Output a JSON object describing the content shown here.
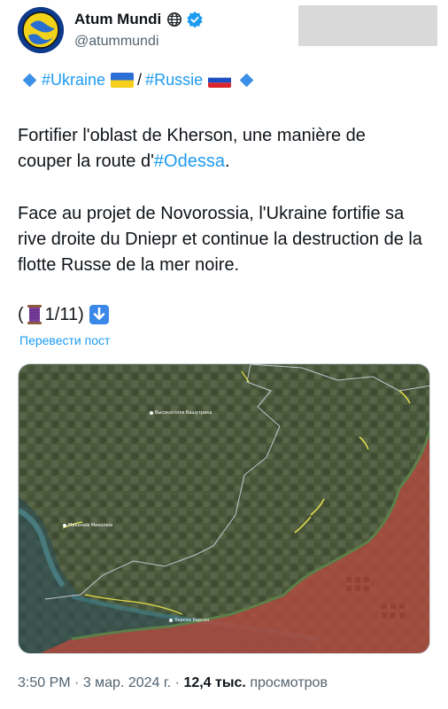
{
  "author": {
    "name": "Atum Mundi",
    "handle": "@atummundi"
  },
  "tags": {
    "ukraine": "#Ukraine",
    "separator": "/",
    "russie": "#Russie"
  },
  "post": {
    "line1_prefix": "Fortifier l'oblast de Kherson, une manière de",
    "line2_prefix": "couper la route d'",
    "line2_tag": "#Odessa",
    "line2_suffix": ".",
    "paragraph2": "Face au projet de Novorossia, l'Ukraine fortifie sa rive droite du Dniepr et continue la destruction de la flotte Russe de la mer noire.",
    "thread_open": "(",
    "thread_count": "1/11)",
    "translate": "Перевести пост"
  },
  "map": {
    "labels": {
      "vysokopillia": "Высокопілля Вашутрика",
      "mykolaiv": "Миколаїв Миколаїв",
      "kherson": "Херсон Херсон"
    }
  },
  "footer": {
    "time": "3:50 PM",
    "dot1": " · ",
    "date": "3 мар. 2024 г.",
    "dot2": " · ",
    "views_count": "12,4 тыс.",
    "views_label": " просмотров"
  },
  "colors": {
    "link": "#1d9bf0",
    "text": "#0f1419",
    "muted": "#536471",
    "occupied": "#b24a3e",
    "verified": "#1d9bf0"
  }
}
